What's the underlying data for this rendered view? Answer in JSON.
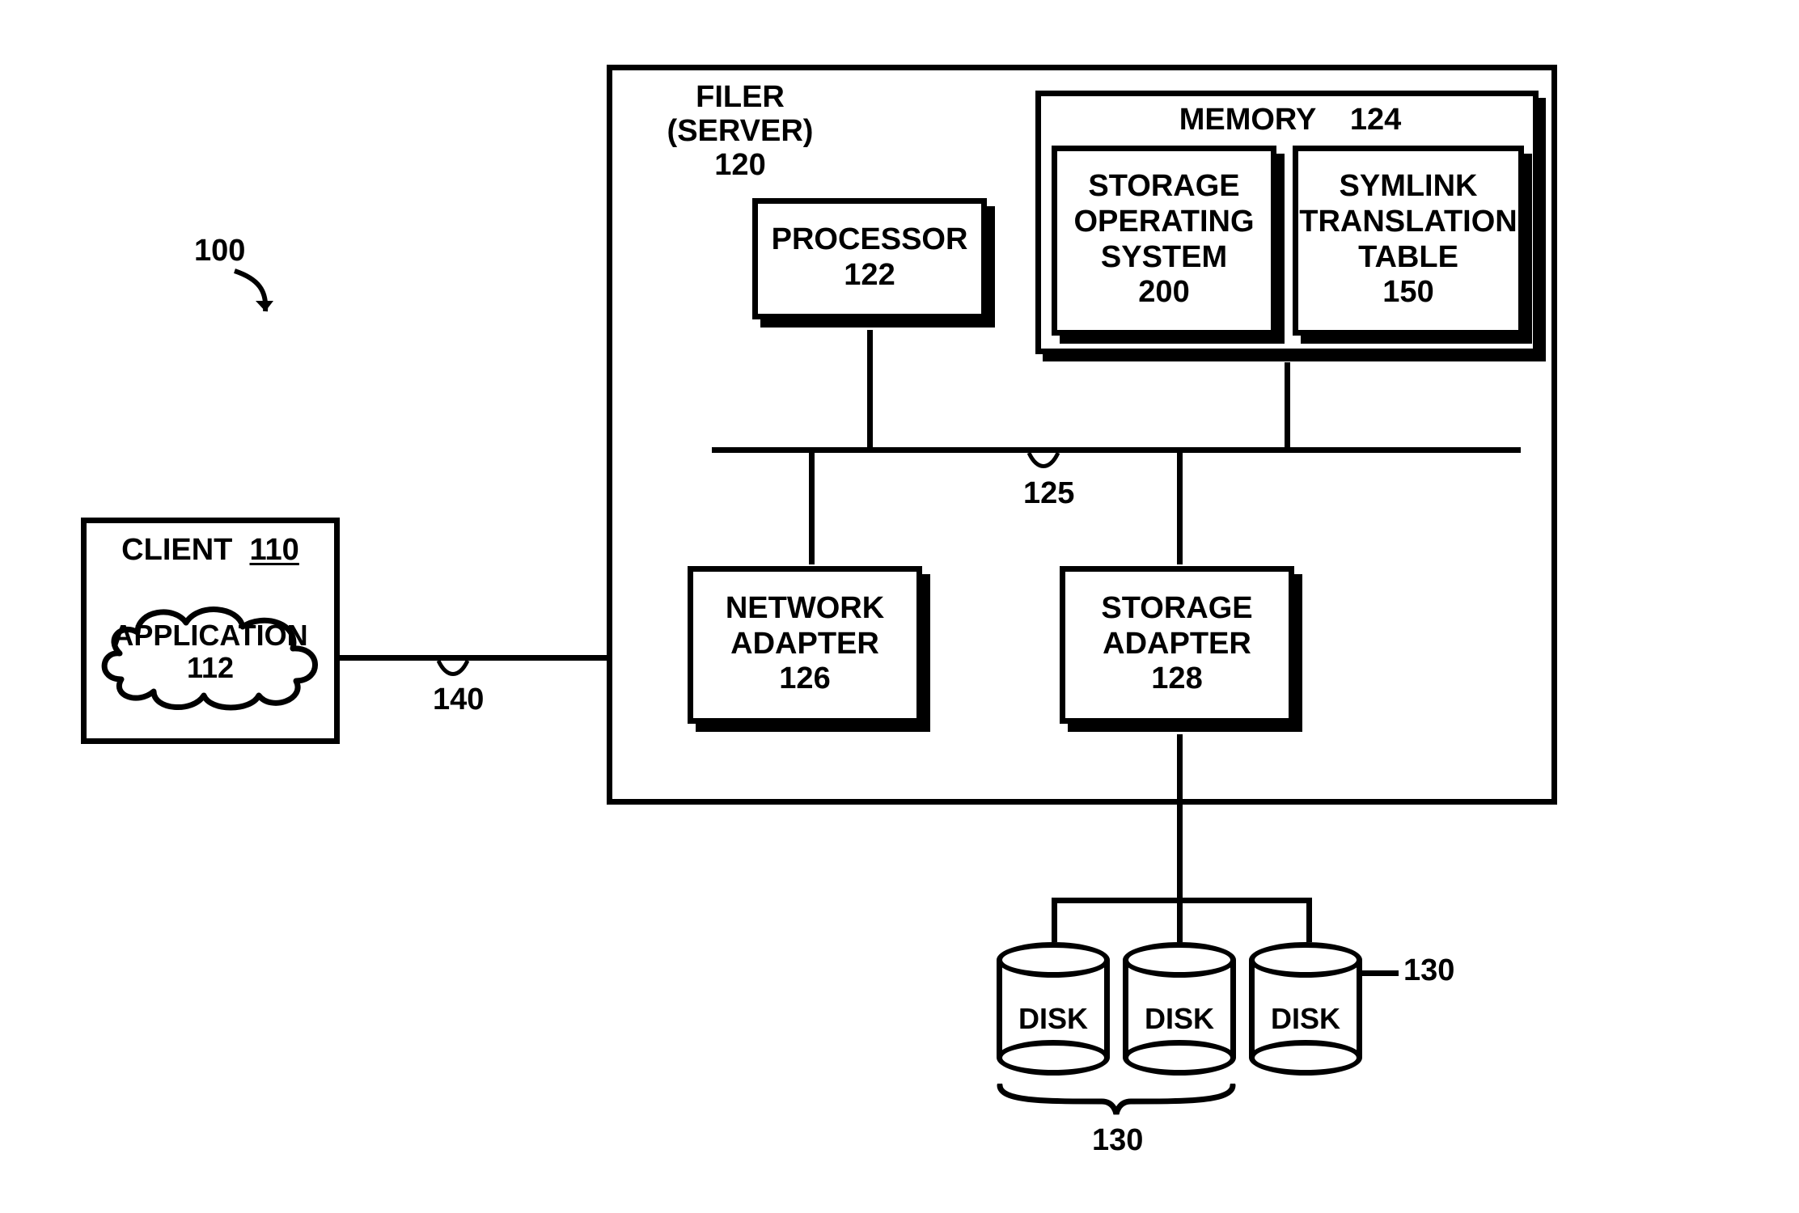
{
  "system_ref": "100",
  "client": {
    "title": "CLIENT",
    "ref": "110",
    "application": {
      "label": "APPLICATION",
      "ref": "112"
    }
  },
  "link_ref": "140",
  "filer": {
    "title_line1": "FILER",
    "title_line2": "(SERVER)",
    "ref": "120",
    "processor": {
      "label": "PROCESSOR",
      "ref": "122"
    },
    "memory": {
      "title": "MEMORY",
      "ref": "124",
      "sos": {
        "line1": "STORAGE",
        "line2": "OPERATING",
        "line3": "SYSTEM",
        "ref": "200"
      },
      "symlink": {
        "line1": "SYMLINK",
        "line2": "TRANSLATION",
        "line3": "TABLE",
        "ref": "150"
      }
    },
    "bus_ref": "125",
    "net_adapter": {
      "line1": "NETWORK",
      "line2": "ADAPTER",
      "ref": "126"
    },
    "storage_adapter": {
      "line1": "STORAGE",
      "line2": "ADAPTER",
      "ref": "128"
    }
  },
  "disks": {
    "label": "DISK",
    "ref": "130",
    "count": 3
  }
}
